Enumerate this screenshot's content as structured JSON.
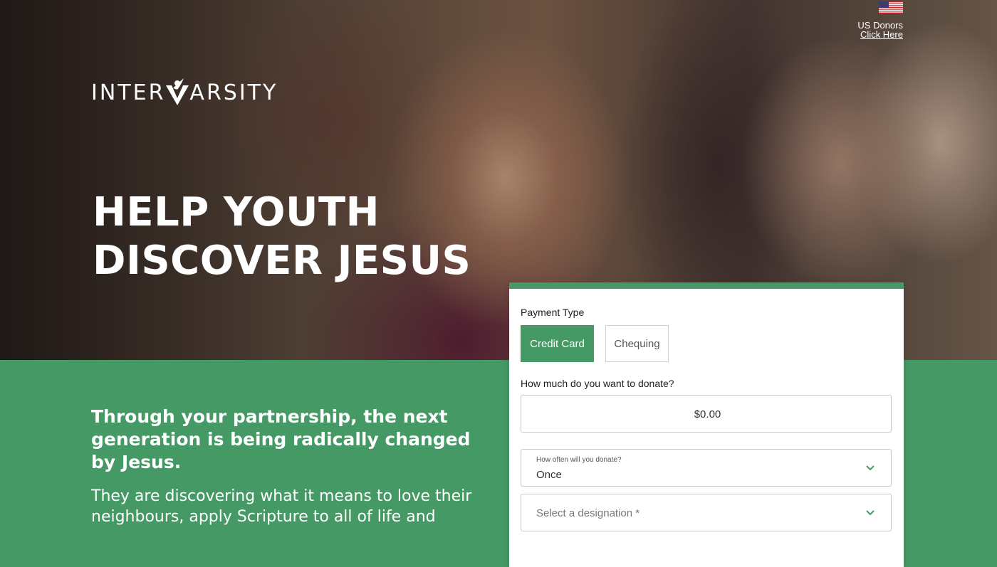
{
  "brand": {
    "logo_text_left": "INTER",
    "logo_text_right": "ARSITY"
  },
  "hero": {
    "headline_line1": "HELP YOUTH",
    "headline_line2": "DISCOVER JESUS"
  },
  "us_donors": {
    "label": "US Donors",
    "link": "Click Here"
  },
  "content": {
    "tagline": "Through your partnership, the next generation is being radically changed by Jesus.",
    "body": "They are discovering what it means to love their neighbours, apply Scripture to all of life and"
  },
  "form": {
    "payment_type_label": "Payment Type",
    "payment_options": [
      "Credit Card",
      "Chequing"
    ],
    "selected_payment": "Credit Card",
    "amount_label": "How much do you want to donate?",
    "amount_value": "$0.00",
    "frequency_label": "How often will you donate?",
    "frequency_value": "Once",
    "designation_placeholder": "Select a designation *"
  },
  "colors": {
    "brand_green": "#459965",
    "white": "#ffffff"
  },
  "icons": {
    "flag": "us-flag-icon",
    "chevron": "chevron-down-icon",
    "logo_mark": "intervarsity-v-icon"
  }
}
